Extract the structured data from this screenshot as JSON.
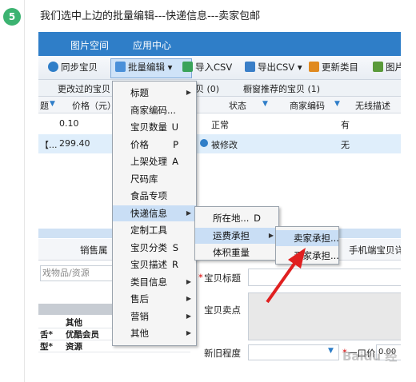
{
  "step": {
    "number": "5",
    "text": "我们选中上边的批量编辑---快递信息---卖家包邮"
  },
  "app": {
    "titlebar_items": [
      "图片空间",
      "应用中心"
    ],
    "toolbar": {
      "sync": "同步宝贝",
      "batch_edit": "批量编辑",
      "import_csv": "导入CSV",
      "export_csv": "导出CSV",
      "update_category": "更新类目",
      "image": "图片"
    },
    "tabs": {
      "changed": "更改过的宝贝 (",
      "count_zero": "贝 (0)",
      "recommended": "橱窗推荐的宝贝 (1)"
    },
    "columns": {
      "title": "题",
      "price": "价格（元）",
      "status": "状态",
      "seller_code": "商家编码",
      "wireless_desc": "无线描述"
    },
    "rows": [
      {
        "title": "",
        "price": "0.10",
        "status": "正常",
        "seller_code": "",
        "wireless": "有"
      },
      {
        "title": "【...",
        "price": "299.40",
        "status": "被修改",
        "seller_code": "",
        "wireless": "无"
      }
    ],
    "lower_tabs": {
      "sales_attr": "销售属",
      "mobile_detail": "手机端宝贝详"
    },
    "left_panel": {
      "input_value": "戏物品/资源",
      "rows": [
        {
          "a": "",
          "b": "其他"
        },
        {
          "a": "舌*",
          "b": "优酷会员"
        },
        {
          "a": "型*",
          "b": "资源"
        }
      ]
    },
    "right_panel": {
      "title_label": "宝贝标题",
      "selling_points_label": "宝贝卖点",
      "condition_label": "新旧程度",
      "price_label": "一口价",
      "price_value": "0.00"
    }
  },
  "menu_batch": {
    "items": [
      {
        "label": "标题",
        "acc": "",
        "sub": true
      },
      {
        "label": "商家编码...",
        "acc": "",
        "sub": false
      },
      {
        "label": "宝贝数量",
        "acc": "U",
        "sub": false
      },
      {
        "label": "价格",
        "acc": "P",
        "sub": false
      },
      {
        "label": "上架处理",
        "acc": "A",
        "sub": false
      },
      {
        "label": "尺码库",
        "acc": "",
        "sub": false
      },
      {
        "label": "食品专项",
        "acc": "",
        "sub": false
      },
      {
        "label": "快递信息",
        "acc": "",
        "sub": true
      },
      {
        "label": "定制工具",
        "acc": "",
        "sub": false
      },
      {
        "label": "宝贝分类",
        "acc": "S",
        "sub": false
      },
      {
        "label": "宝贝描述",
        "acc": "R",
        "sub": false
      },
      {
        "label": "类目信息",
        "acc": "",
        "sub": true
      },
      {
        "label": "售后",
        "acc": "",
        "sub": true
      },
      {
        "label": "营销",
        "acc": "",
        "sub": true
      },
      {
        "label": "其他",
        "acc": "",
        "sub": true
      }
    ]
  },
  "menu_express": {
    "items": [
      {
        "label": "所在地...",
        "acc": "D",
        "sub": false
      },
      {
        "label": "运费承担",
        "acc": "",
        "sub": true
      },
      {
        "label": "体积重量",
        "acc": "",
        "sub": false
      }
    ]
  },
  "menu_shipping": {
    "items": [
      {
        "label": "卖家承担...",
        "acc": ""
      },
      {
        "label": "买家承担...",
        "acc": ""
      }
    ]
  },
  "watermark": "Baidu 经验",
  "colors": {
    "badge": "#3cb371",
    "titlebar": "#2f7ec8",
    "highlight": "#c9def5",
    "arrow": "#e02020"
  }
}
